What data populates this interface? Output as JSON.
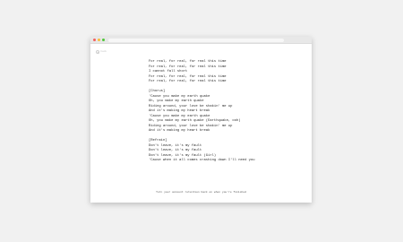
{
  "colors": {
    "red": "#f4605c",
    "yellow": "#f8bd3b",
    "green": "#4fc73a"
  },
  "nav": {
    "back_label": "back"
  },
  "lyrics": [
    "For real, for real, for real this time",
    "For real, for real, for real this time",
    "I cannot fall short",
    "For real, for real, for real this time",
    "For real, for real, for real this time",
    "",
    "[Chorus]",
    "'Cause you make my earth quake",
    "Oh, you make my earth quake",
    "Riding around, your love be shakin' me up",
    "And it's making my heart break",
    "'Cause you make my earth quake",
    "Oh, you make my earth quake (Earthquake, ooh)",
    "Riding around, your love be shakin' me up",
    "And it's making my heart break",
    "",
    "[Refrain]",
    "Don't leave, it's my fault",
    "Don't leave, it's my fault",
    "Don't leave, it's my fault (Girl)",
    "'Cause when it all comes crashing down I'll need you"
  ],
  "footer": "Turn your account retention back on when you're finished"
}
